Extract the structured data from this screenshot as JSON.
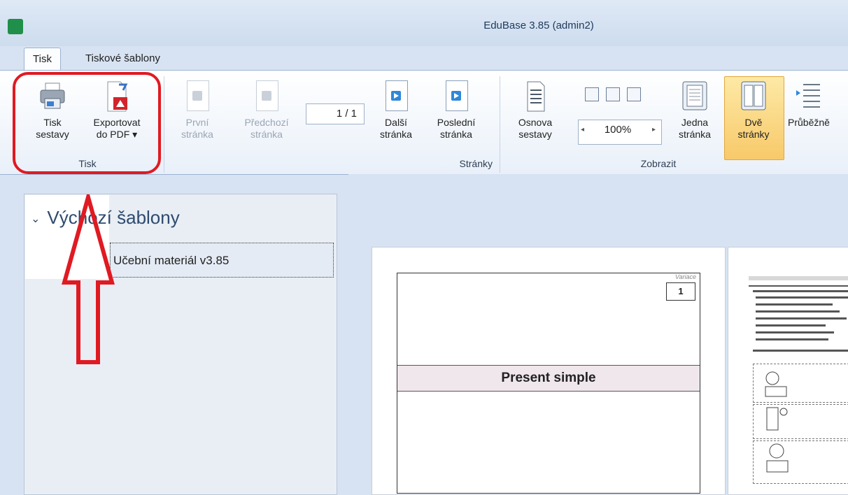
{
  "window": {
    "title": "EduBase 3.85 (admin2)"
  },
  "tabs": [
    "Tisk",
    "Tiskové šablony"
  ],
  "ribbon": {
    "tisk_group": {
      "label": "Tisk",
      "print_button": [
        "Tisk",
        "sestavy"
      ],
      "export_button": [
        "Exportovat",
        "do PDF ▾"
      ]
    },
    "stranky_group": {
      "label": "Stránky",
      "first": [
        "První",
        "stránka"
      ],
      "previous": [
        "Předchozí",
        "stránka"
      ],
      "counter": "1 / 1",
      "next": [
        "Další",
        "stránka"
      ],
      "last": [
        "Poslední",
        "stránka"
      ]
    },
    "zobrazit_group": {
      "label": "Zobrazit",
      "outline": [
        "Osnova",
        "sestavy"
      ],
      "zoom": "100%",
      "one_page": [
        "Jedna",
        "stránka"
      ],
      "two_pages": [
        "Dvě",
        "stránky"
      ],
      "continuous": "Průběžně"
    }
  },
  "templates": {
    "group": "Výchozí šablony",
    "items": [
      "Učební materiál v3.85"
    ]
  },
  "preview": {
    "variant_label": "Variace",
    "variant_number": "1",
    "title": "Present simple"
  },
  "colors": {
    "annotation": "#e01a22",
    "selected": "#f8c969"
  }
}
